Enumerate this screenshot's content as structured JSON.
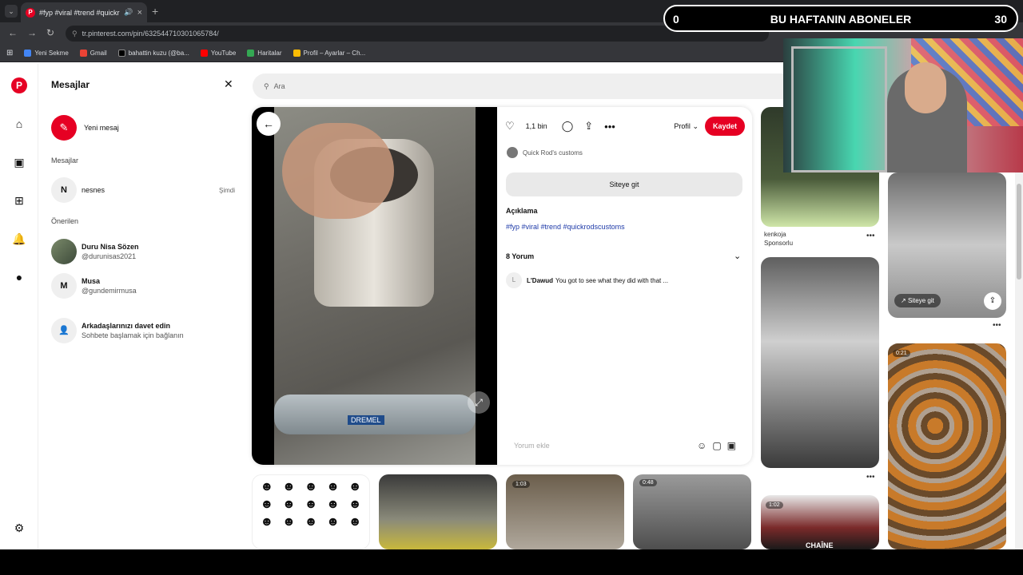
{
  "browser": {
    "tab_title": "#fyp #viral #trend #quickr",
    "address": "tr.pinterest.com/pin/632544710301065784/",
    "bookmarks": [
      "Yeni Sekme",
      "Gmail",
      "bahattin kuzu (@ba...",
      "YouTube",
      "Haritalar",
      "Profil – Ayarlar – Ch..."
    ]
  },
  "messages": {
    "title": "Mesajlar",
    "new_message": "Yeni mesaj",
    "section_messages": "Mesajlar",
    "conversation": {
      "initial": "N",
      "name": "nesnes",
      "time": "Şimdi"
    },
    "section_suggested": "Önerilen",
    "suggestions": [
      {
        "name": "Duru Nisa Sözen",
        "handle": "@durunisas2021"
      },
      {
        "name": "Musa",
        "handle": "@gundemirmusa",
        "initial": "M"
      }
    ],
    "invite_title": "Arkadaşlarınızı davet edin",
    "invite_sub": "Sohbete başlamak için bağlanın"
  },
  "search": {
    "placeholder": "Ara"
  },
  "pin": {
    "likes": "1,1 bin",
    "profile_label": "Profil",
    "save_label": "Kaydet",
    "author": "Quick Rod's customs",
    "visit_label": "Siteye git",
    "description_heading": "Açıklama",
    "tags": "#fyp #viral #trend #quickrodscustoms",
    "comments_heading": "8 Yorum",
    "comment_author": "L'Dawud",
    "comment_text": "You got to see what they did with that ...",
    "comment_initial": "L",
    "add_comment_placeholder": "Yorum ekle",
    "video_badge": "DREMEL"
  },
  "grid": {
    "sponsor_name": "kenkoja",
    "sponsor_label": "Sponsorlu",
    "visit_label": "Siteye git",
    "durations": [
      "0:21",
      "1:02",
      "1:03",
      "0:48"
    ],
    "chaine_label": "CHAÎNE"
  },
  "overlay": {
    "left": "0",
    "center": "BU HAFTANIN ABONELER",
    "right": "30"
  }
}
